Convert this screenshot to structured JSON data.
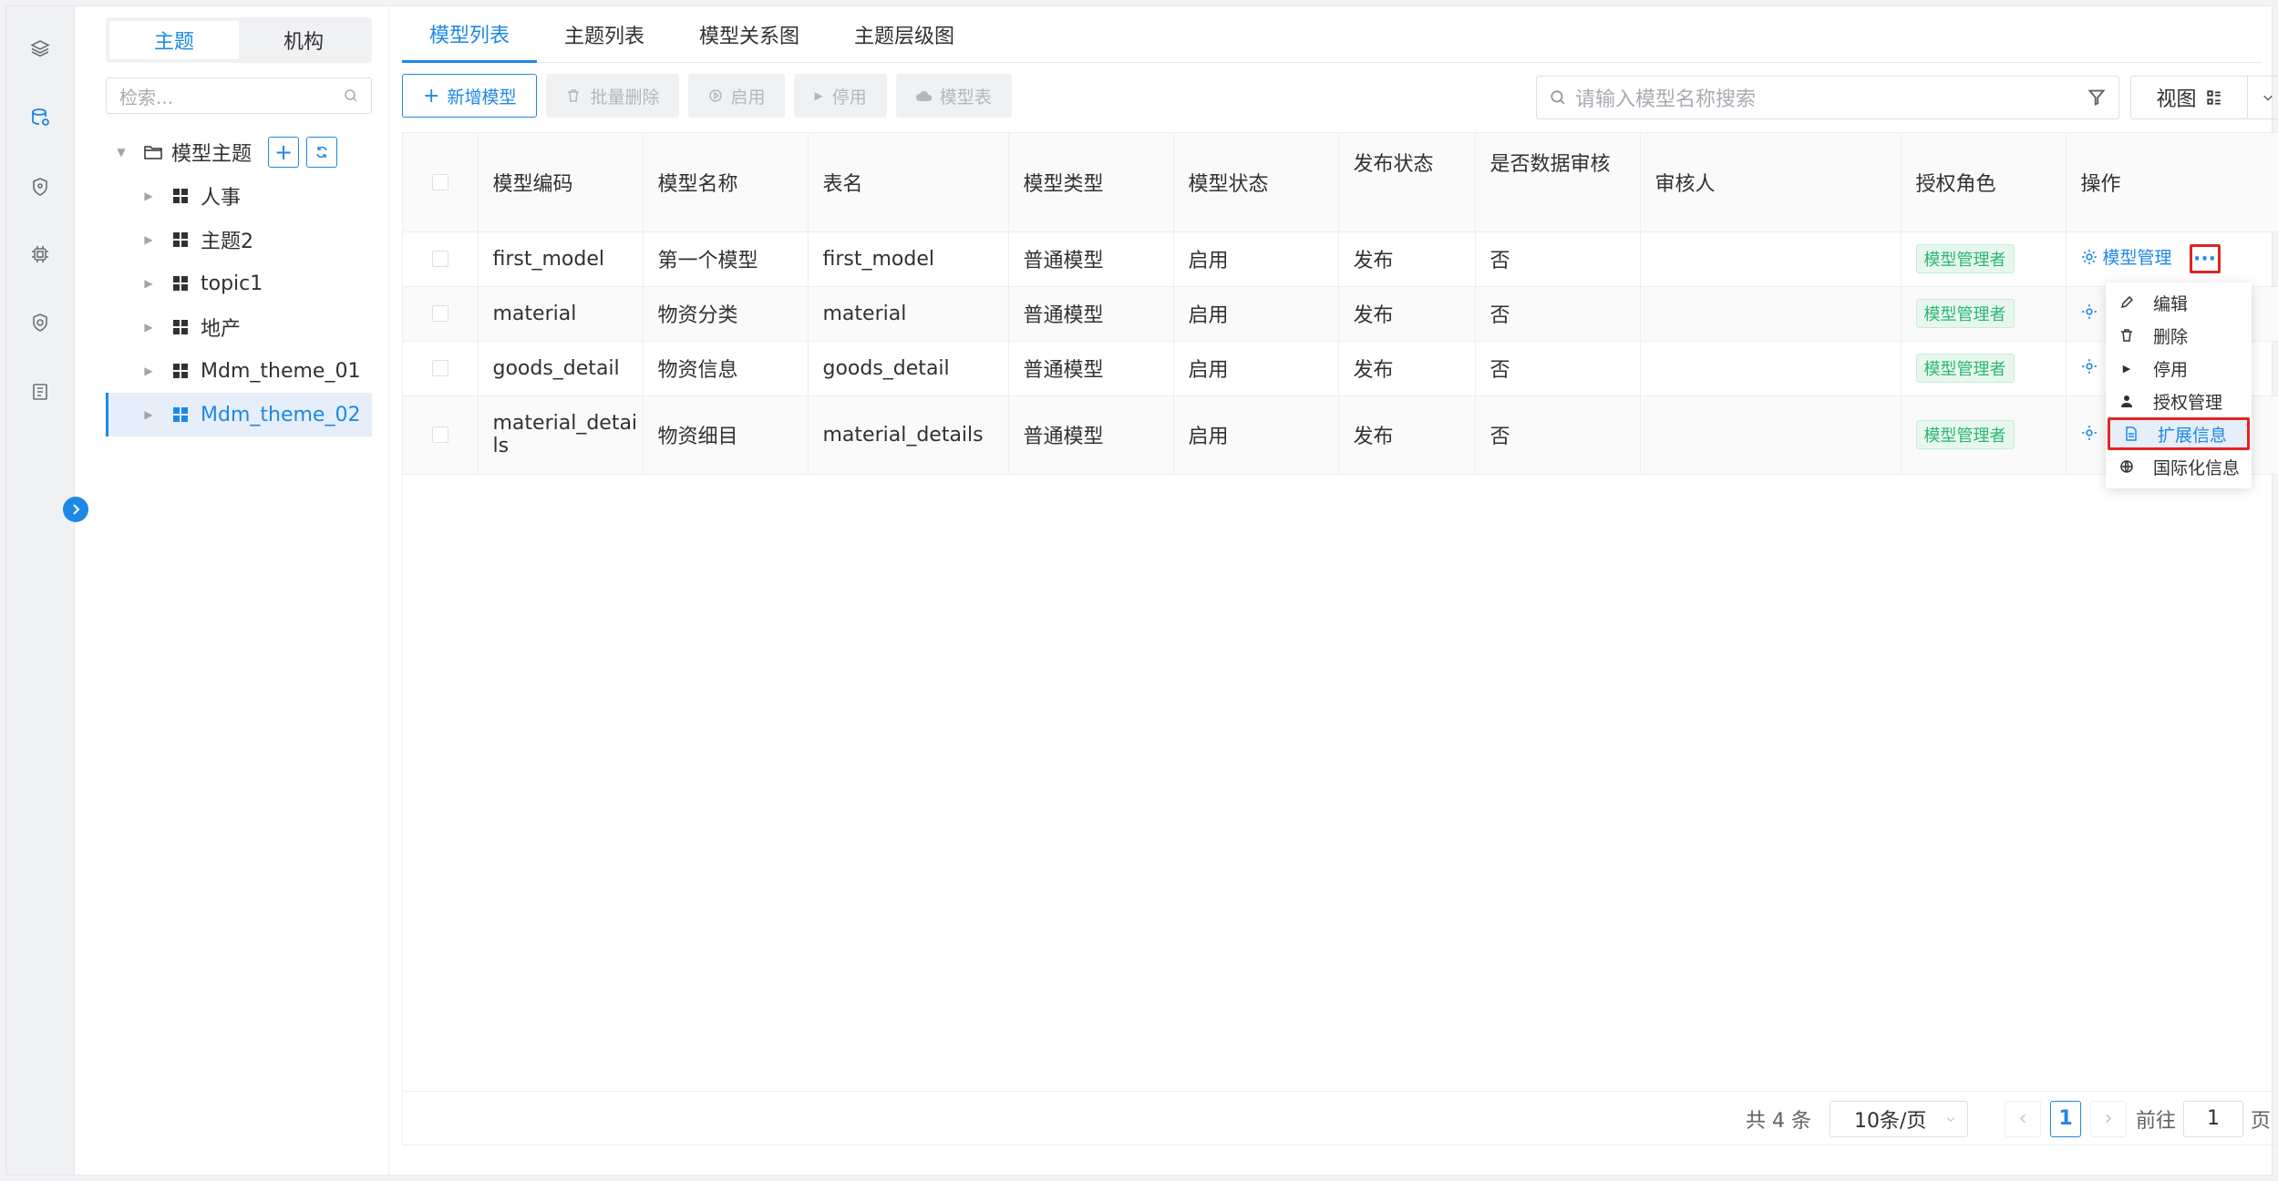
{
  "tree_panel": {
    "segments": [
      "主题",
      "机构"
    ],
    "search_placeholder": "检索...",
    "root_label": "模型主题",
    "items": [
      "人事",
      "主题2",
      "topic1",
      "地产",
      "Mdm_theme_01",
      "Mdm_theme_02"
    ],
    "selected": "Mdm_theme_02"
  },
  "tabs": [
    "模型列表",
    "主题列表",
    "模型关系图",
    "主题层级图"
  ],
  "toolbar": {
    "add": "新增模型",
    "batch_delete": "批量删除",
    "enable": "启用",
    "disable": "停用",
    "model_table": "模型表"
  },
  "search": {
    "placeholder": "请输入模型名称搜索"
  },
  "view": {
    "label": "视图"
  },
  "table": {
    "headers": [
      "模型编码",
      "模型名称",
      "表名",
      "模型类型",
      "模型状态",
      "发布状态",
      "是否数据审核",
      "审核人",
      "授权角色",
      "操作"
    ],
    "rows": [
      {
        "code": "first_model",
        "name": "第一个模型",
        "table": "first_model",
        "type": "普通模型",
        "status": "启用",
        "publish": "发布",
        "audit": "否",
        "reviewer": "",
        "role": "模型管理者"
      },
      {
        "code": "material",
        "name": "物资分类",
        "table": "material",
        "type": "普通模型",
        "status": "启用",
        "publish": "发布",
        "audit": "否",
        "reviewer": "",
        "role": "模型管理者"
      },
      {
        "code": "goods_detail",
        "name": "物资信息",
        "table": "goods_detail",
        "type": "普通模型",
        "status": "启用",
        "publish": "发布",
        "audit": "否",
        "reviewer": "",
        "role": "模型管理者"
      },
      {
        "code": "material_details",
        "code_line1": "material_detai",
        "code_line2": "ls",
        "name": "物资细目",
        "table": "material_details",
        "type": "普通模型",
        "status": "启用",
        "publish": "发布",
        "audit": "否",
        "reviewer": "",
        "role": "模型管理者"
      }
    ],
    "op_label": "模型管理",
    "more_label": "···"
  },
  "menu": {
    "items": [
      "编辑",
      "删除",
      "停用",
      "授权管理",
      "扩展信息",
      "国际化信息"
    ],
    "highlighted": "扩展信息"
  },
  "pager": {
    "total": "共 4 条",
    "size": "10条/页",
    "page": "1",
    "goto_label": "前往",
    "goto_value": "1",
    "page_suffix": "页"
  },
  "colors": {
    "accent": "#1e88e5",
    "highlight_border": "#e02424",
    "tag_green": "#2bb673"
  }
}
